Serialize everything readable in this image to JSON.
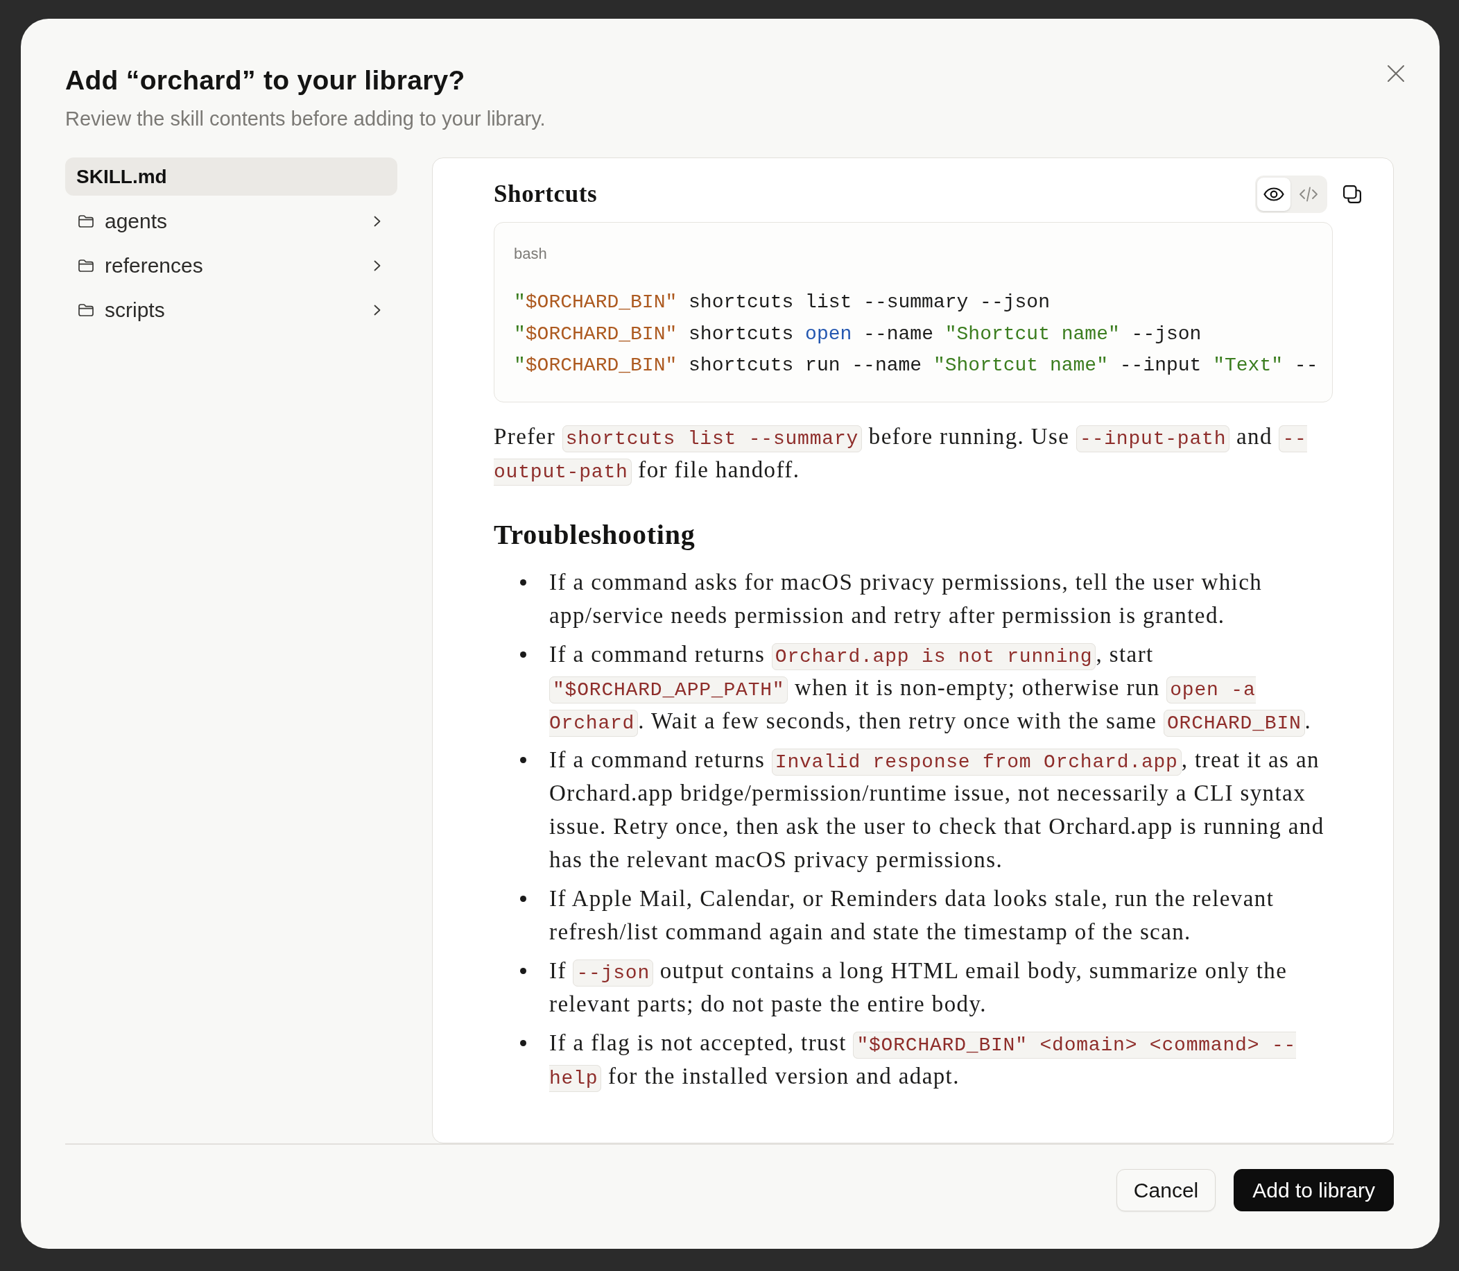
{
  "dialog": {
    "title": "Add “orchard” to your library?",
    "subtitle": "Review the skill contents before adding to your library."
  },
  "sidebar": {
    "items": [
      {
        "kind": "file",
        "label": "SKILL.md",
        "selected": true
      },
      {
        "kind": "folder",
        "label": "agents",
        "selected": false,
        "expanded": false
      },
      {
        "kind": "folder",
        "label": "references",
        "selected": false,
        "expanded": false
      },
      {
        "kind": "folder",
        "label": "scripts",
        "selected": false,
        "expanded": false
      }
    ]
  },
  "viewer": {
    "toolbar": [
      {
        "kind": "preview",
        "selected": true
      },
      {
        "kind": "source",
        "selected": false
      }
    ],
    "blocks": [
      {
        "kind": "subheading",
        "text": "Shortcuts"
      },
      {
        "kind": "code",
        "language": "bash",
        "lines": [
          [
            {
              "kind": "string",
              "text": "\""
            },
            {
              "kind": "variable",
              "text": "$ORCHARD_BIN\""
            },
            {
              "kind": "plain",
              "text": " shortcuts list --summary --json"
            }
          ],
          [
            {
              "kind": "string",
              "text": "\""
            },
            {
              "kind": "variable",
              "text": "$ORCHARD_BIN\""
            },
            {
              "kind": "plain",
              "text": " shortcuts "
            },
            {
              "kind": "builtin",
              "text": "open"
            },
            {
              "kind": "plain",
              "text": " --name "
            },
            {
              "kind": "string",
              "text": "\"Shortcut name\""
            },
            {
              "kind": "plain",
              "text": " --json"
            }
          ],
          [
            {
              "kind": "string",
              "text": "\""
            },
            {
              "kind": "variable",
              "text": "$ORCHARD_BIN\""
            },
            {
              "kind": "plain",
              "text": " shortcuts run --name "
            },
            {
              "kind": "string",
              "text": "\"Shortcut name\""
            },
            {
              "kind": "plain",
              "text": " --input "
            },
            {
              "kind": "string",
              "text": "\"Text\""
            },
            {
              "kind": "plain",
              "text": " --"
            }
          ]
        ]
      },
      {
        "kind": "paragraph",
        "segments": [
          {
            "kind": "text",
            "text": "Prefer "
          },
          {
            "kind": "code",
            "text": "shortcuts list --summary"
          },
          {
            "kind": "text",
            "text": " before running. Use "
          },
          {
            "kind": "code",
            "text": "--input-path"
          },
          {
            "kind": "text",
            "text": " and "
          },
          {
            "kind": "code",
            "text": "--output-path"
          },
          {
            "kind": "text",
            "text": " for file handoff."
          }
        ]
      },
      {
        "kind": "heading",
        "text": "Troubleshooting"
      },
      {
        "kind": "list",
        "items": [
          [
            {
              "kind": "text",
              "text": "If a command asks for macOS privacy permissions, tell the user which app/service needs permission and retry after permission is granted."
            }
          ],
          [
            {
              "kind": "text",
              "text": "If a command returns "
            },
            {
              "kind": "code",
              "text": "Orchard.app is not running"
            },
            {
              "kind": "text",
              "text": ", start "
            },
            {
              "kind": "code",
              "text": "\"$ORCHARD_APP_PATH\""
            },
            {
              "kind": "text",
              "text": " when it is non-empty; otherwise run "
            },
            {
              "kind": "code",
              "text": "open -a Orchard"
            },
            {
              "kind": "text",
              "text": ". Wait a few seconds, then retry once with the same "
            },
            {
              "kind": "code",
              "text": "ORCHARD_BIN"
            },
            {
              "kind": "text",
              "text": "."
            }
          ],
          [
            {
              "kind": "text",
              "text": "If a command returns "
            },
            {
              "kind": "code",
              "text": "Invalid response from Orchard.app"
            },
            {
              "kind": "text",
              "text": ", treat it as an Orchard.app bridge/permission/runtime issue, not necessarily a CLI syntax issue. Retry once, then ask the user to check that Orchard.app is running and has the relevant macOS privacy permissions."
            }
          ],
          [
            {
              "kind": "text",
              "text": "If Apple Mail, Calendar, or Reminders data looks stale, run the relevant refresh/list command again and state the timestamp of the scan."
            }
          ],
          [
            {
              "kind": "text",
              "text": "If "
            },
            {
              "kind": "code",
              "text": "--json"
            },
            {
              "kind": "text",
              "text": " output contains a long HTML email body, summarize only the relevant parts; do not paste the entire body."
            }
          ],
          [
            {
              "kind": "text",
              "text": "If a flag is not accepted, trust "
            },
            {
              "kind": "code",
              "text": "\"$ORCHARD_BIN\" <domain> <command> --help"
            },
            {
              "kind": "text",
              "text": " for the installed version and adapt."
            }
          ]
        ]
      }
    ]
  },
  "footer": {
    "buttons": [
      {
        "kind": "secondary",
        "label": "Cancel"
      },
      {
        "kind": "primary",
        "label": "Add to library"
      }
    ]
  }
}
